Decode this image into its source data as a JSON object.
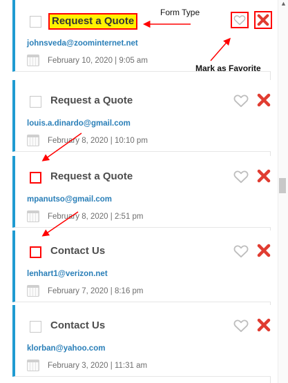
{
  "annotations": {
    "form_type": "Form Type",
    "mark_favorite": "Mark as Favorite"
  },
  "entries": [
    {
      "form_type": "Request a Quote",
      "email": "johnsveda@zoominternet.net",
      "date": "February 10, 2020 | 9:05 am"
    },
    {
      "form_type": "Request a Quote",
      "email": "louis.a.dinardo@gmail.com",
      "date": "February 8, 2020 | 10:10 pm"
    },
    {
      "form_type": "Request a Quote",
      "email": "mpanutso@gmail.com",
      "date": "February 8, 2020 | 2:51 pm"
    },
    {
      "form_type": "Contact Us",
      "email": "lenhart1@verizon.net",
      "date": "February 7, 2020 | 8:16 pm"
    },
    {
      "form_type": "Contact Us",
      "email": "klorban@yahoo.com",
      "date": "February 3, 2020 | 11:31 am"
    }
  ],
  "icons": {
    "favorite": "heart-icon",
    "delete": "close-icon",
    "calendar": "calendar-icon",
    "scroll_up": "chevron-up-icon"
  },
  "colors": {
    "accent": "#1f9bd1",
    "email": "#2a7fb8",
    "delete": "#e03c31",
    "annotation": "#ff0000",
    "highlight": "#fff200"
  }
}
